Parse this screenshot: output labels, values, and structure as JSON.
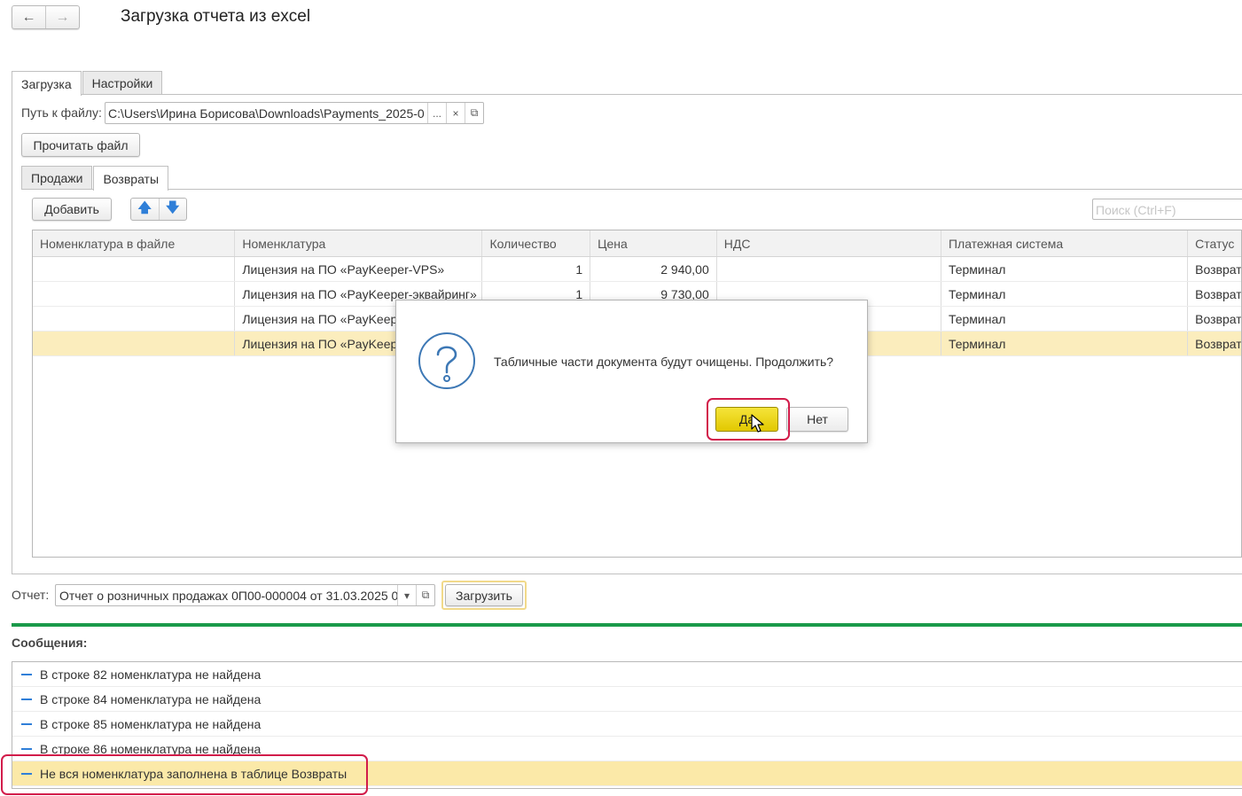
{
  "window": {
    "title": "Загрузка отчета из excel"
  },
  "nav": {
    "back_icon": "←",
    "forward_icon": "→"
  },
  "tabs": [
    {
      "label": "Загрузка"
    },
    {
      "label": "Настройки"
    }
  ],
  "file": {
    "label": "Путь к файлу:",
    "value": "C:\\Users\\Ирина Борисова\\Downloads\\Payments_2025-0",
    "browse": "...",
    "clear": "×",
    "open": "⧉"
  },
  "read_button": "Прочитать файл",
  "subtabs": [
    {
      "label": "Продажи"
    },
    {
      "label": "Возвраты"
    }
  ],
  "toolbar": {
    "add": "Добавить",
    "up": "🡅",
    "down": "🡇",
    "search_placeholder": "Поиск (Ctrl+F)"
  },
  "table": {
    "columns": [
      "Номенклатура в файле",
      "Номенклатура",
      "Количество",
      "Цена",
      "НДС",
      "Платежная система",
      "Статус"
    ],
    "rows": [
      [
        "",
        "Лицензия на ПО «PayKeeper-VPS»",
        "1",
        "2 940,00",
        "",
        "Терминал",
        "Возврат"
      ],
      [
        "",
        "Лицензия на ПО «PayKeeper-эквайринг»",
        "1",
        "9 730,00",
        "",
        "Терминал",
        "Возврат"
      ],
      [
        "",
        "Лицензия на ПО «PayKeep",
        "",
        "",
        "",
        "Терминал",
        "Возврат"
      ],
      [
        "",
        "Лицензия на ПО «PayKeep",
        "",
        "",
        "",
        "Терминал",
        "Возврат"
      ]
    ]
  },
  "report": {
    "label": "Отчет:",
    "value": "Отчет о розничных продажах 0П00-000004 от 31.03.2025 0",
    "dropdown": "▾",
    "open": "⧉",
    "load_button": "Загрузить"
  },
  "messages": {
    "title": "Сообщения:",
    "items": [
      "В строке 82 номенклатура не найдена",
      "В строке 84 номенклатура не найдена",
      "В строке 85 номенклатура не найдена",
      "В строке 86 номенклатура не найдена",
      "Не вся номенклатура заполнена в таблице Возвраты"
    ]
  },
  "dialog": {
    "icon": "question-icon",
    "text": "Табличные части документа будут очищены. Продолжить?",
    "yes": "Да",
    "no": "Нет"
  },
  "colors": {
    "accent_yellow": "#e2c800",
    "highlight_red": "#d21c4a",
    "green_bar": "#1a9a4a",
    "selected_row": "#fbedbd"
  }
}
